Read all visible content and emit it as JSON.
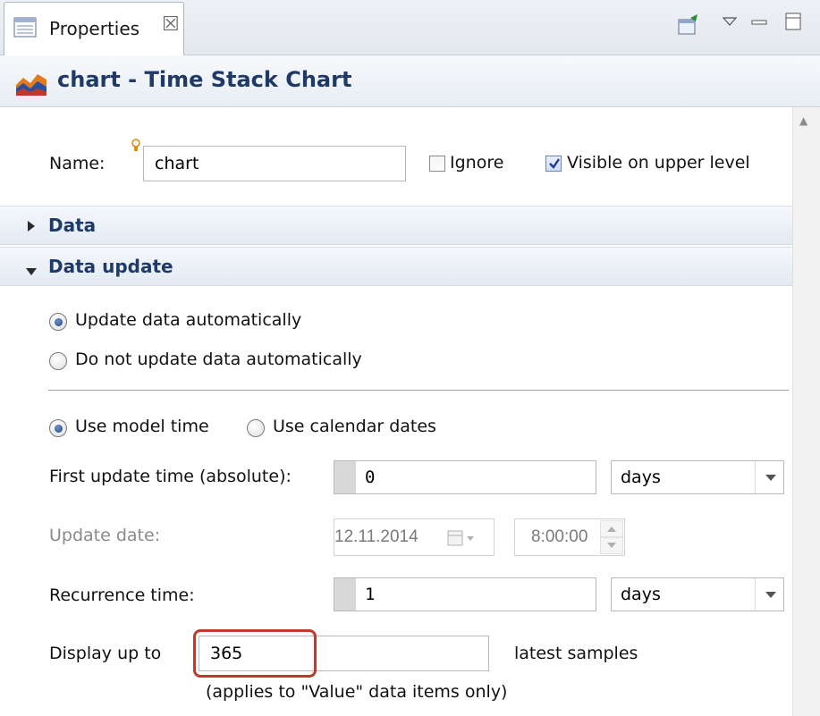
{
  "tab": {
    "title": "Properties",
    "close_glyph": "☒"
  },
  "view_toolbar": {
    "new_view_icon": "pin-icon",
    "menu_icon": "view-menu-icon",
    "minimize_icon": "minimize-icon",
    "maximize_icon": "maximize-icon"
  },
  "header": {
    "title": "chart - Time Stack Chart",
    "icon": "time-stack-chart-icon"
  },
  "name_row": {
    "label": "Name:",
    "value": "chart",
    "ignore_label": "Ignore",
    "ignore_checked": false,
    "visible_label": "Visible on upper level",
    "visible_checked": true
  },
  "sections": {
    "data": "Data",
    "data_update": "Data update"
  },
  "update_mode": {
    "auto_label": "Update data automatically",
    "manual_label": "Do not update data automatically",
    "selected": "auto"
  },
  "time_mode": {
    "model_time_label": "Use model time",
    "calendar_label": "Use calendar dates",
    "selected": "model"
  },
  "first_update": {
    "label": "First update time (absolute):",
    "value": "0",
    "unit": "days"
  },
  "update_date": {
    "label": "Update date:",
    "date": "12.11.2014",
    "time": "8:00:00"
  },
  "recurrence": {
    "label": "Recurrence time:",
    "value": "1",
    "unit": "days"
  },
  "display": {
    "label": "Display up to",
    "value": "365",
    "suffix": "latest samples",
    "note": "(applies to \"Value\" data items only)"
  },
  "colors": {
    "accent": "#1f3a66",
    "highlight": "#c0392b"
  }
}
